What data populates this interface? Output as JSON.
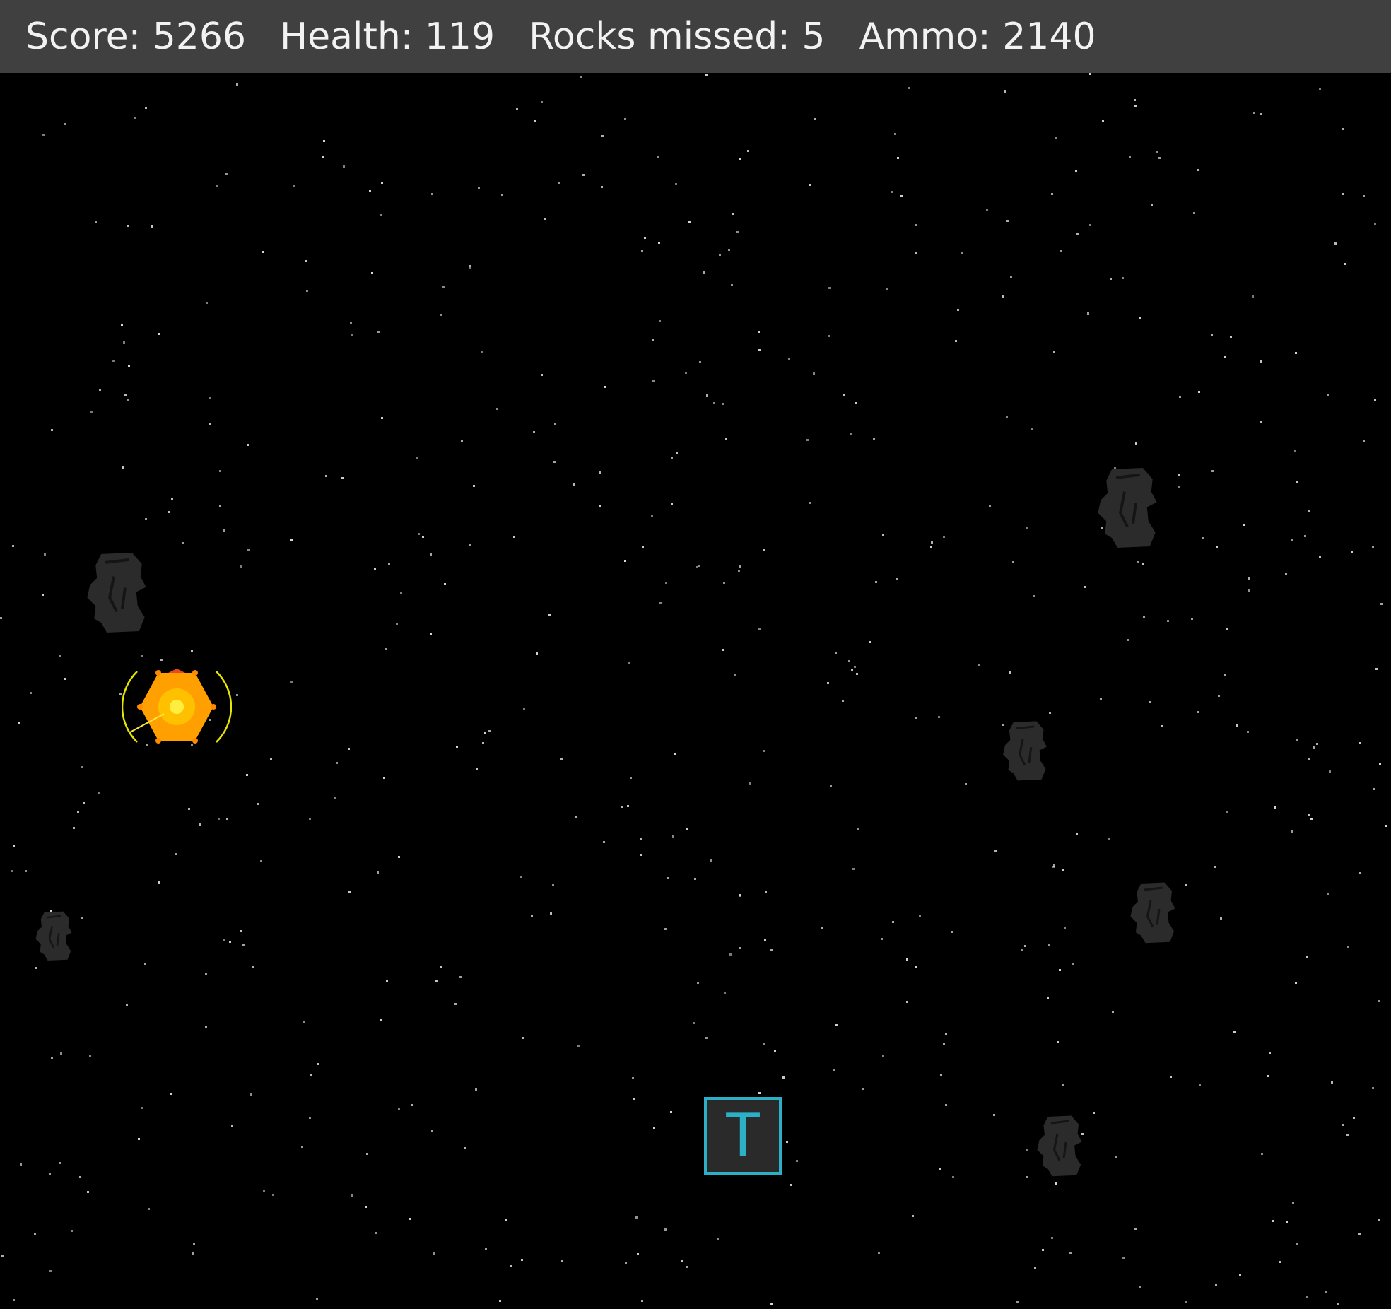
{
  "hud": {
    "score_label": "Score: 5266",
    "health_label": "Health: 119",
    "rocks_missed_label": "Rocks missed: 5",
    "ammo_label": "Ammo: 2140"
  },
  "game": {
    "score": 5266,
    "health": 119,
    "rocks_missed": 5,
    "ammo": 2140
  },
  "powerup": {
    "letter": "T",
    "color": "#2bb0c8"
  },
  "colors": {
    "background": "#000000",
    "hud_background": "#404040",
    "hud_text": "#f2f2f2",
    "rock": "#2b2b2b",
    "ship_core": "#ffb000",
    "ship_shield": "#e6e600"
  },
  "icons": {
    "player": "ship-icon",
    "rock": "moai-rock-icon",
    "crate": "loot-crate-icon",
    "powerup": "powerup-icon"
  }
}
